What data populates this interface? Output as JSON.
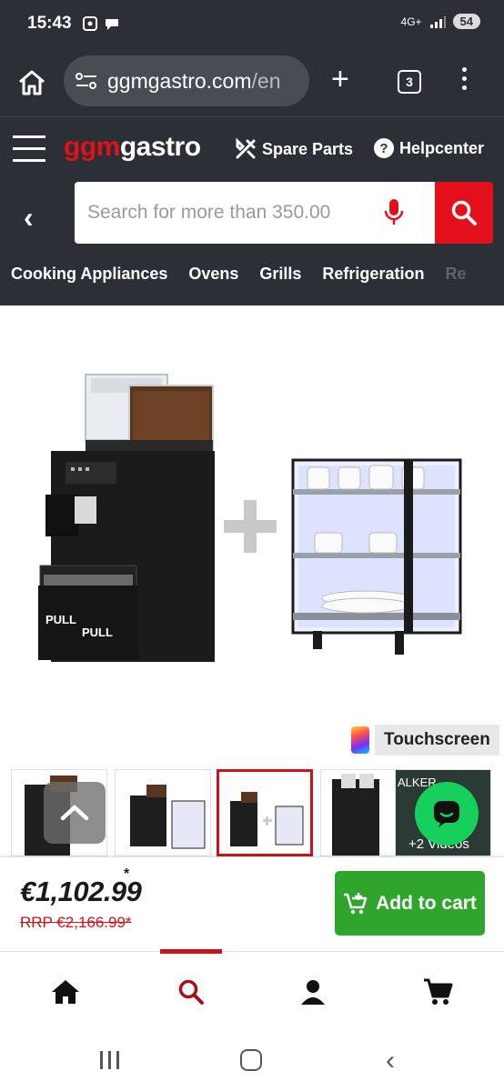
{
  "status": {
    "time": "15:43",
    "network": "4G+",
    "battery": "54"
  },
  "browser": {
    "url_domain": "ggmgastro.com",
    "url_tail": "/en",
    "tab_count": "3"
  },
  "site": {
    "logo_ggm": "ggm",
    "logo_gastro": "gastro",
    "spare_parts": "Spare Parts",
    "helpcenter": "Helpcenter",
    "help_symbol": "?",
    "search_placeholder": "Search for more than 350.00",
    "categories": [
      "Cooking Appliances",
      "Ovens",
      "Grills",
      "Refrigeration",
      "Re"
    ]
  },
  "product": {
    "badge": "Touchscreen",
    "pull_label": "PULL",
    "video_thumb_top": "ALKER",
    "video_thumb_label": "+2 Videos",
    "price": "€1,102.99",
    "price_asterisk": "*",
    "rrp": "RRP €2,166.99*",
    "add_to_cart": "Add to cart"
  },
  "colors": {
    "brand_red": "#e3101c",
    "header_bg": "#2b3036",
    "cart_green": "#2fa52b",
    "chat_green": "#15d15c"
  },
  "bottom_nav": [
    "home-icon",
    "search-icon",
    "account-icon",
    "cart-icon"
  ]
}
